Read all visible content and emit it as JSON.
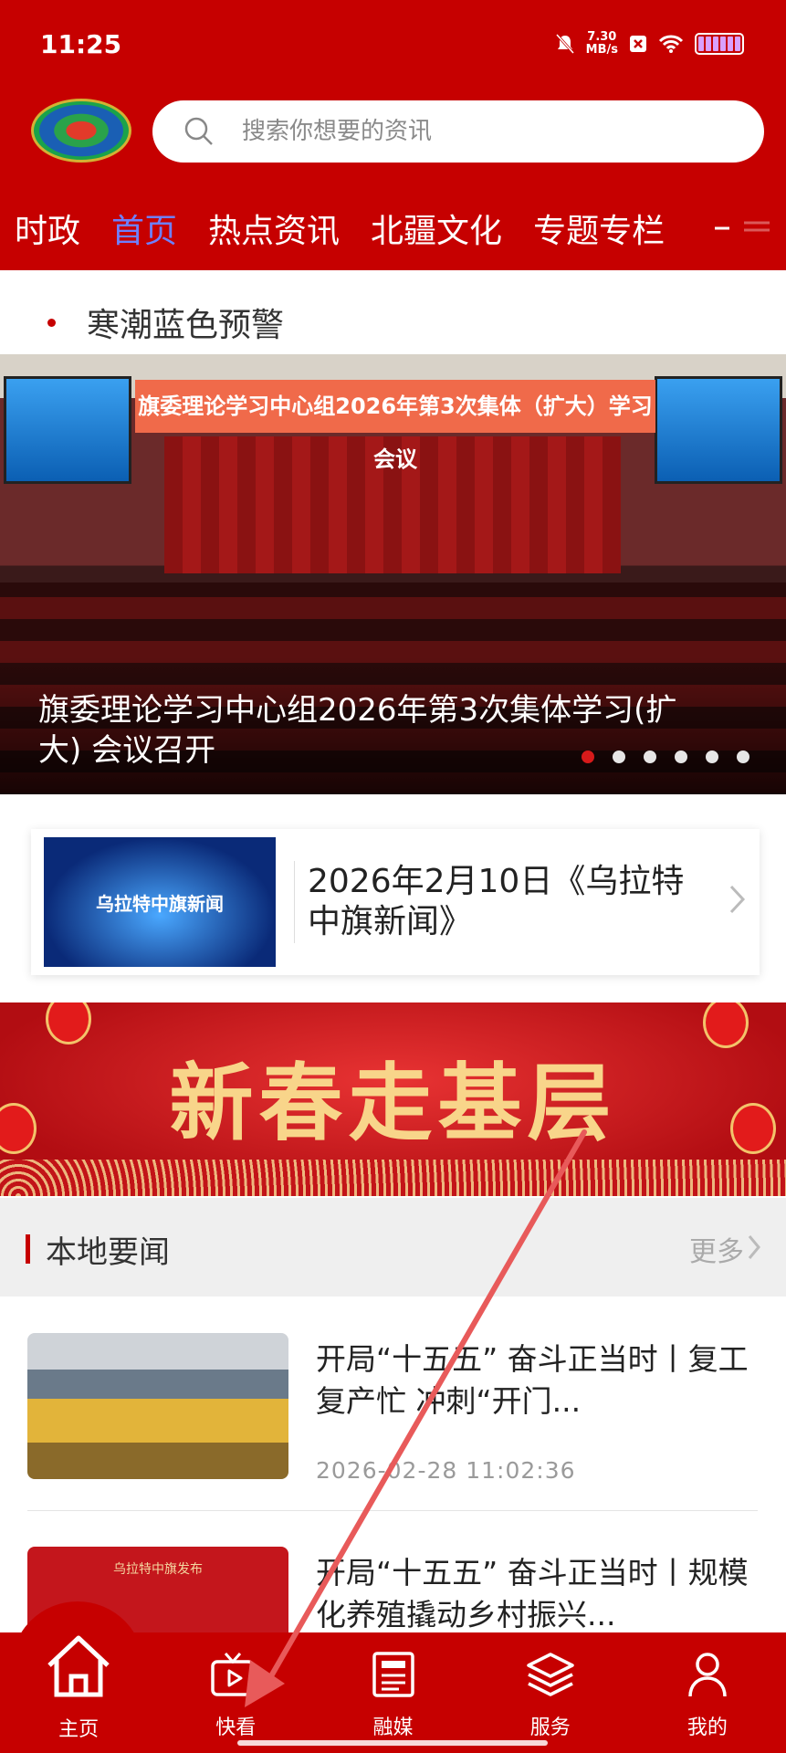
{
  "status_bar": {
    "time": "11:25",
    "net_speed": "7.30",
    "net_unit": "MB/s"
  },
  "search": {
    "placeholder": "搜索你想要的资讯"
  },
  "nav": {
    "tabs": [
      "时政",
      "首页",
      "热点资讯",
      "北疆文化",
      "专题专栏"
    ],
    "active": "首页"
  },
  "alert": {
    "text": "寒潮蓝色预警"
  },
  "banner": {
    "stage_title": "旗委理论学习中心组2026年第3次集体（扩大）学习会议",
    "caption": "旗委理论学习中心组2026年第3次集体学习(扩大) 会议召开",
    "active_slide": 1,
    "slide_count": 6
  },
  "video_card": {
    "thumb_text": "乌拉特中旗新闻",
    "title": "2026年2月10日《乌拉特中旗新闻》"
  },
  "spring_banner": {
    "text": "新春走基层"
  },
  "section": {
    "name": "本地要闻",
    "more": "更多"
  },
  "news": [
    {
      "title": "开局“十五五” 奋斗正当时丨复工复产忙 冲刺“开门...",
      "date": "2026-02-28 11:02:36"
    },
    {
      "title": "开局“十五五” 奋斗正当时丨规模化养殖撬动乡村振兴...",
      "thumb_text": "乌拉特中旗发布"
    }
  ],
  "tabbar": {
    "items": [
      {
        "label": "主页",
        "icon": "home-icon"
      },
      {
        "label": "快看",
        "icon": "tv-icon"
      },
      {
        "label": "融媒",
        "icon": "newspaper-icon"
      },
      {
        "label": "服务",
        "icon": "layers-icon"
      },
      {
        "label": "我的",
        "icon": "person-icon"
      }
    ]
  },
  "colors": {
    "brand_red": "#c60000",
    "active_tab": "#6e80ff",
    "accent_gold": "#f8d58a"
  }
}
